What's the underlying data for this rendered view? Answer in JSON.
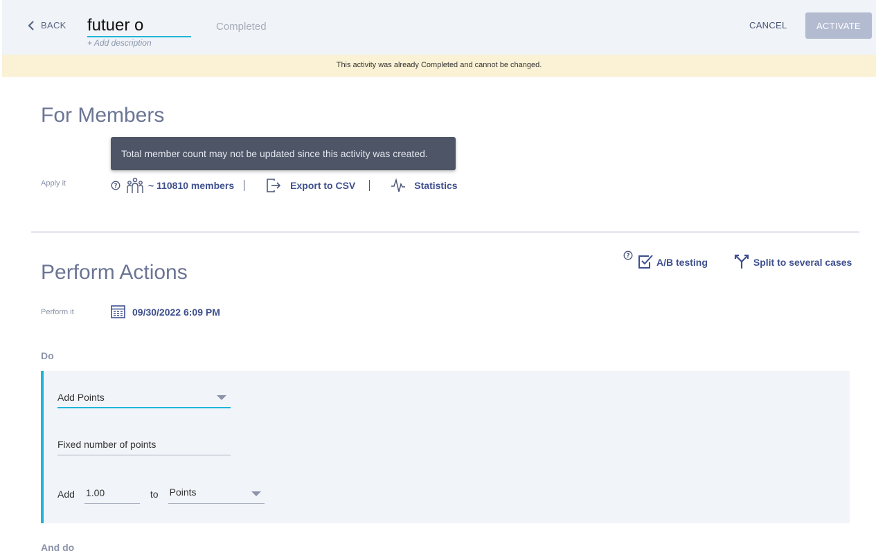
{
  "header": {
    "back_label": "BACK",
    "title_value": "futuer o",
    "add_description": "+ Add description",
    "status": "Completed",
    "cancel_label": "CANCEL",
    "activate_label": "ACTIVATE"
  },
  "banner": {
    "text": "This activity was already Completed and cannot be changed."
  },
  "members_section": {
    "title": "For Members",
    "tooltip": "Total member count may not be updated since this activity was created.",
    "apply_label": "Apply it",
    "member_count": "~ 110810 members",
    "export_label": "Export to CSV",
    "statistics_label": "Statistics"
  },
  "actions_section": {
    "title": "Perform Actions",
    "ab_testing_label": "A/B testing",
    "split_label": "Split to several cases",
    "perform_label": "Perform it",
    "datetime": "09/30/2022 6:09 PM",
    "do_label": "Do",
    "and_do_label": "And do",
    "action": {
      "type": "Add Points",
      "mode": "Fixed number of points",
      "add_label": "Add",
      "amount": "1.00",
      "to_label": "to",
      "target": "Points"
    }
  },
  "colors": {
    "accent": "#1db5d8",
    "link": "#3e4f8e",
    "banner": "#fbf1d5"
  }
}
